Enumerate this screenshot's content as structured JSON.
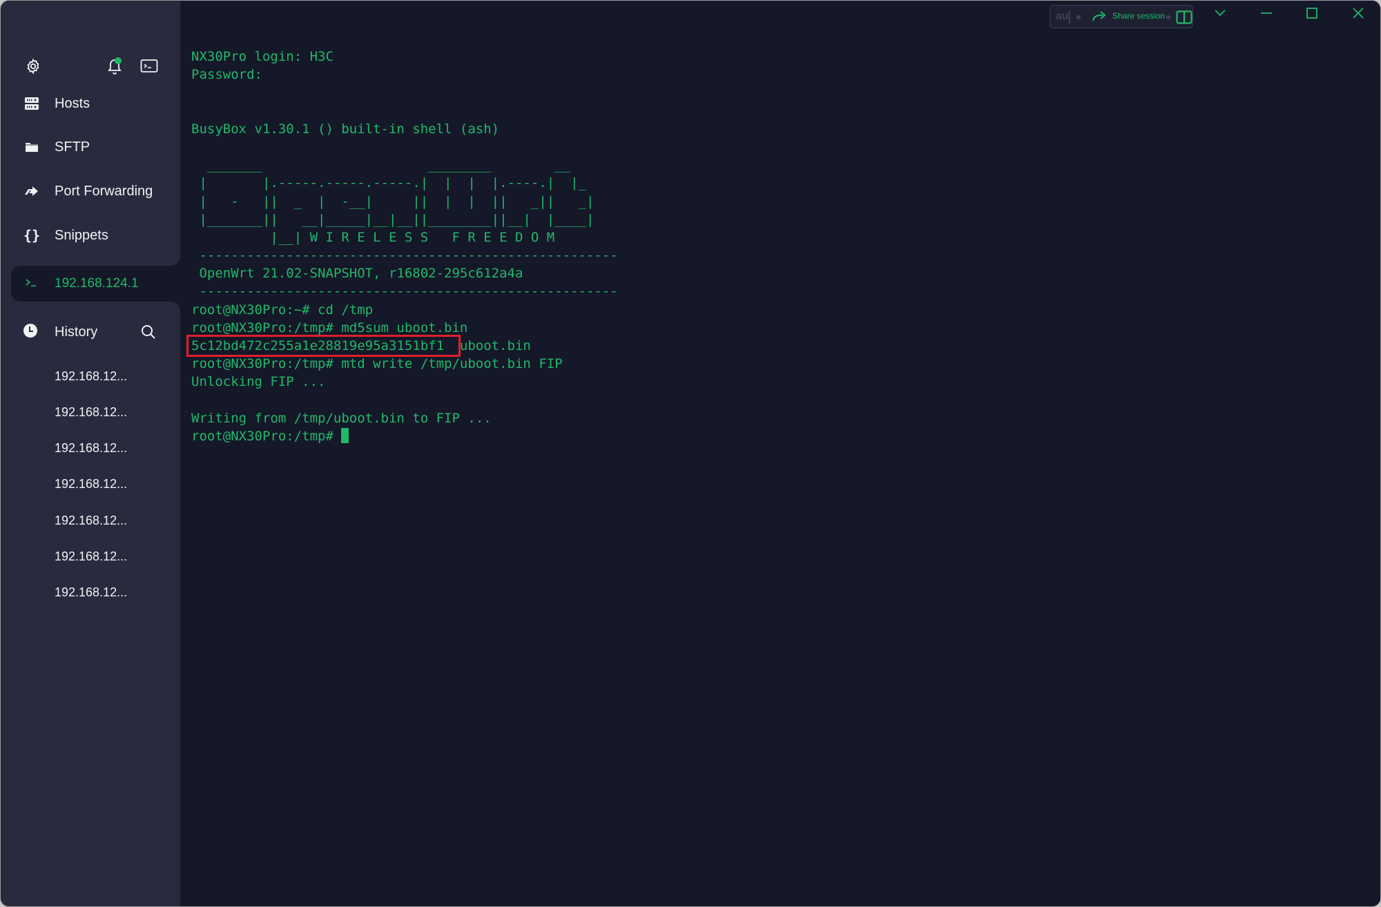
{
  "colors": {
    "accent": "#22b86a",
    "sidebar_bg": "#282b3e",
    "terminal_bg": "#141828",
    "highlight": "#e0202a"
  },
  "sidebar": {
    "top_icons": [
      "gear-icon",
      "bell-icon",
      "terminal-icon"
    ],
    "nav": [
      {
        "label": "Hosts",
        "icon": "hosts-icon"
      },
      {
        "label": "SFTP",
        "icon": "folder-icon"
      },
      {
        "label": "Port Forwarding",
        "icon": "port-forward-icon"
      },
      {
        "label": "Snippets",
        "icon": "braces-icon"
      }
    ],
    "active_session": {
      "label": "192.168.124.1",
      "icon": "prompt-icon"
    },
    "history": {
      "label": "History",
      "items": [
        "192.168.12...",
        "192.168.12...",
        "192.168.12...",
        "192.168.12...",
        "192.168.12...",
        "192.168.12...",
        "192.168.12..."
      ]
    }
  },
  "toolbar": {
    "input_text": "au",
    "share_label": "Share session"
  },
  "terminal": {
    "lines": [
      "NX30Pro login: H3C",
      "Password:",
      "",
      "",
      "BusyBox v1.30.1 () built-in shell (ash)",
      "",
      "  _______                     ________        __",
      " |       |.-----.-----.-----.|  |  |  |.----.|  |_",
      " |   -   ||  _  |  -__|     ||  |  |  ||   _||   _|",
      " |_______||   __|_____|__|__||________||__|  |____|",
      "          |__| W I R E L E S S   F R E E D O M",
      " -----------------------------------------------------",
      " OpenWrt 21.02-SNAPSHOT, r16802-295c612a4a",
      " -----------------------------------------------------",
      "root@NX30Pro:~# cd /tmp",
      "root@NX30Pro:/tmp# md5sum uboot.bin",
      "5c12bd472c255a1e28819e95a3151bf1  uboot.bin",
      "root@NX30Pro:/tmp# mtd write /tmp/uboot.bin FIP",
      "Unlocking FIP ...",
      "",
      "Writing from /tmp/uboot.bin to FIP ..."
    ],
    "prompt": "root@NX30Pro:/tmp# "
  }
}
